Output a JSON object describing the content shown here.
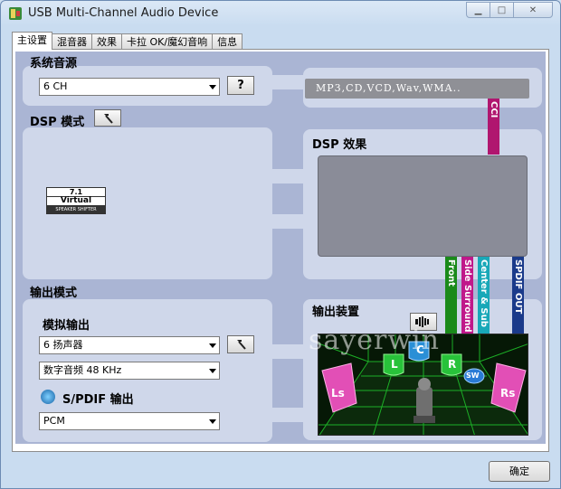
{
  "window": {
    "title": "USB Multi-Channel Audio Device"
  },
  "tabs": [
    "主设置",
    "混音器",
    "效果",
    "卡拉 OK/魔幻音响",
    "信息"
  ],
  "main": {
    "system_audio_label": "系统音源",
    "channel_select": "6 CH",
    "help_button": "?",
    "formats": "MP3,CD,VCD,Wav,WMA..",
    "dsp_mode_label": "DSP 模式",
    "virtual_badge": {
      "top": "7.1",
      "middle": "Virtual",
      "bottom": "SPEAKER SHIFTER"
    },
    "dsp_effect_label": "DSP 效果",
    "output_mode_label": "输出模式",
    "analog_output_label": "模拟输出",
    "speaker_select": "6 扬声器",
    "digital_select": "数字音频 48 KHz",
    "spdif_label": "S/PDIF 输出",
    "pcm_select": "PCM",
    "output_device_label": "输出装置",
    "watermark": "sayerwin"
  },
  "connectors": {
    "cci": {
      "label": "CCI",
      "color": "#b0166f"
    },
    "front": {
      "label": "Front",
      "color": "#1a8a1a"
    },
    "side_surround": {
      "label": "Side Surround",
      "color": "#c0188a"
    },
    "center_sub": {
      "label": "Center & Sub",
      "color": "#18a8b8"
    },
    "spdif_out": {
      "label": "SPDIF OUT",
      "color": "#1a3a8a"
    }
  },
  "scene": {
    "speakers": {
      "left": "L",
      "center": "C",
      "right": "R",
      "subwoofer": "SW",
      "left_surround": "Ls",
      "right_surround": "Rs"
    },
    "colors": {
      "grid": "#1fbf2a",
      "front": "#28c23a",
      "surround": "#e24fb6",
      "sub": "#2a7bd6"
    }
  },
  "footer": {
    "ok_button": "确定"
  }
}
